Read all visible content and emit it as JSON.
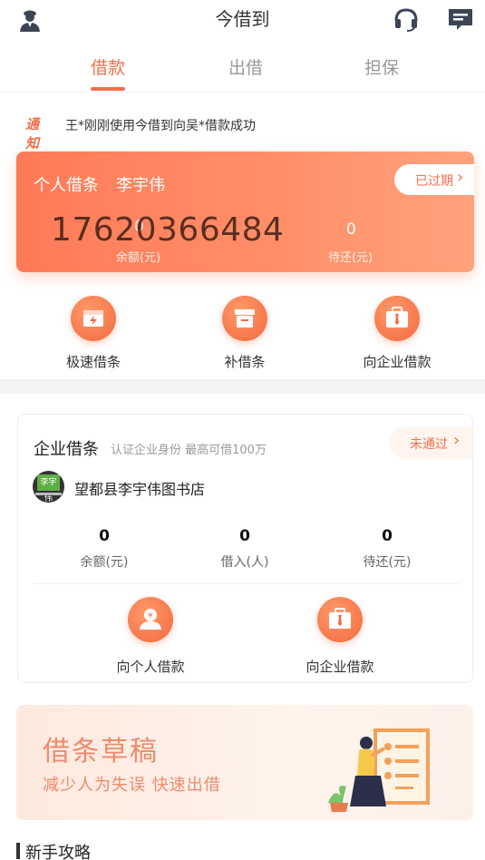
{
  "app": {
    "title": "今借到"
  },
  "header": {
    "left_icon": "user-service-icon",
    "right_icons": [
      "headset-icon",
      "message-icon"
    ]
  },
  "tabs": [
    {
      "label": "借款",
      "active": true
    },
    {
      "label": "出借",
      "active": false
    },
    {
      "label": "担保",
      "active": false
    }
  ],
  "notice": {
    "tag": "通知",
    "text": "王*刚刚使用今借到向吴*借款成功"
  },
  "personal_card": {
    "title": "个人借条",
    "name": "李宇伟",
    "status": "已过期",
    "phone": "17620366484",
    "balance_value": "0",
    "balance_label": "余额(元)",
    "due_value": "0",
    "due_label": "待还(元)"
  },
  "quick_actions": [
    {
      "label": "极速借条",
      "icon": "lightning-box-icon"
    },
    {
      "label": "补借条",
      "icon": "document-box-icon"
    },
    {
      "label": "向企业借款",
      "icon": "briefcase-icon"
    }
  ],
  "enterprise_card": {
    "title": "企业借条",
    "subtitle": "认证企业身份 最高可借100万",
    "status": "未通过",
    "avatar_text": "李宇伟",
    "shop_name": "望都县李宇伟图书店",
    "stats": [
      {
        "value": "0",
        "label": "余额(元)"
      },
      {
        "value": "0",
        "label": "借入(人)"
      },
      {
        "value": "0",
        "label": "待还(元)"
      }
    ],
    "actions": [
      {
        "label": "向个人借款",
        "icon": "person-yuan-icon"
      },
      {
        "label": "向企业借款",
        "icon": "briefcase-icon"
      }
    ]
  },
  "draft_banner": {
    "title": "借条草稿",
    "subtitle": "减少人为失误 快速出借"
  },
  "guide": {
    "title": "新手攻略"
  },
  "colors": {
    "accent": "#f26f4b",
    "card_gradient_start": "#ff7a57",
    "card_gradient_end": "#ffa27c"
  }
}
